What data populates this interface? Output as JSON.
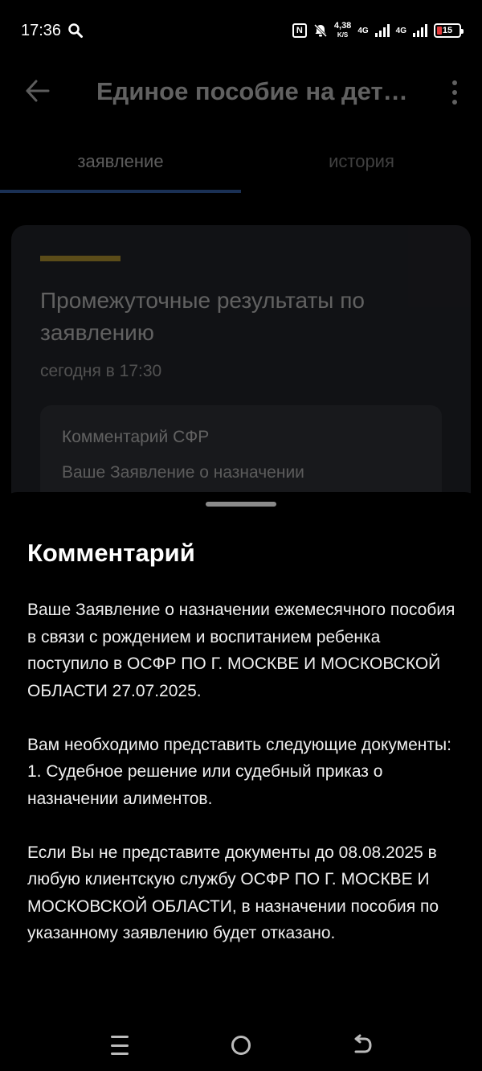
{
  "status_bar": {
    "time": "17:36",
    "speed_value": "4,38",
    "speed_unit": "K/S",
    "network1": "4G",
    "network2": "4G",
    "battery": "15",
    "battery_color": "#e23b3b"
  },
  "header": {
    "title": "Единое пособие на дет…"
  },
  "tabs": [
    {
      "label": "заявление",
      "active": true
    },
    {
      "label": "история",
      "active": false
    }
  ],
  "card": {
    "title": "Промежуточные результаты по заявлению",
    "time": "сегодня в 17:30",
    "comment_label": "Комментарий СФР",
    "comment_preview": "Ваше Заявление о назначении"
  },
  "sheet": {
    "title": "Комментарий",
    "paragraphs": [
      "Ваше Заявление о назначении ежемесячного пособия в связи с рождением и воспитанием ребенка поступило в ОСФР ПО Г. МОСКВЕ И МОСКОВСКОЙ ОБЛАСТИ 27.07.2025.",
      "Вам необходимо представить следующие документы:\n1. Судебное решение или судебный приказ о назначении алиментов.",
      "Если Вы не представите документы до 08.08.2025 в любую клиентскую службу ОСФР ПО Г. МОСКВЕ И МОСКОВСКОЙ ОБЛАСТИ, в назначении пособия по указанному заявлению будет отказано."
    ]
  },
  "colors": {
    "accent": "#d9b53c",
    "tab_active": "#3e74c9"
  }
}
